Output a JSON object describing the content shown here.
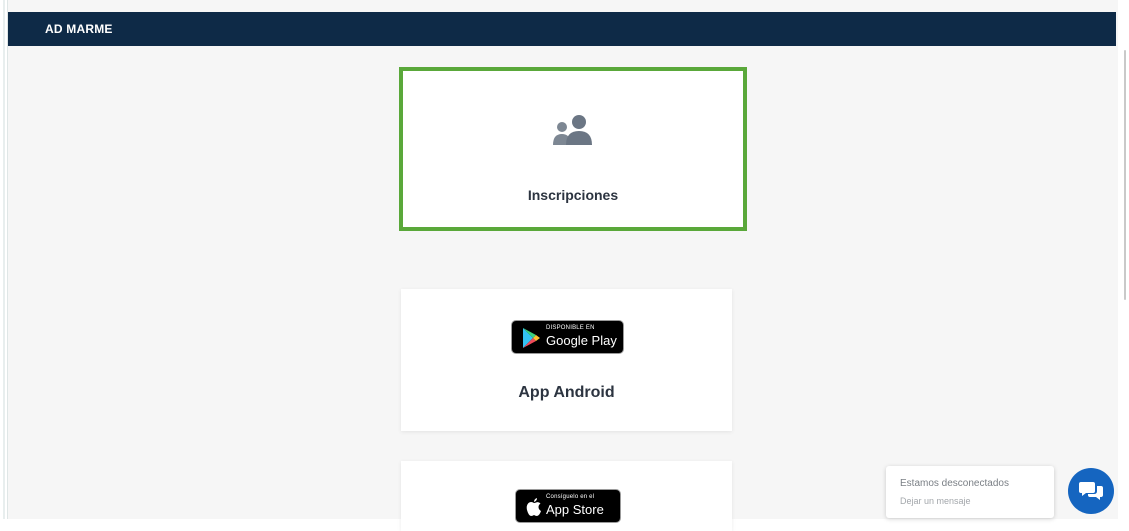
{
  "header": {
    "title": "AD MARME"
  },
  "cards": {
    "inscripciones": {
      "label": "Inscripciones",
      "icon": "users-icon",
      "highlight_color": "#5aa83a"
    },
    "android": {
      "label": "App Android",
      "badge_small": "DISPONIBLE EN",
      "badge_big": "Google Play"
    },
    "ios": {
      "badge_small": "Consíguelo en el",
      "badge_big": "App Store"
    }
  },
  "chat": {
    "status": "Estamos desconectados",
    "subtext": "Dejar un mensaje",
    "icon": "chat-bubbles-icon"
  },
  "colors": {
    "header_bg": "#0e2a47",
    "chat_button": "#1565c0"
  }
}
